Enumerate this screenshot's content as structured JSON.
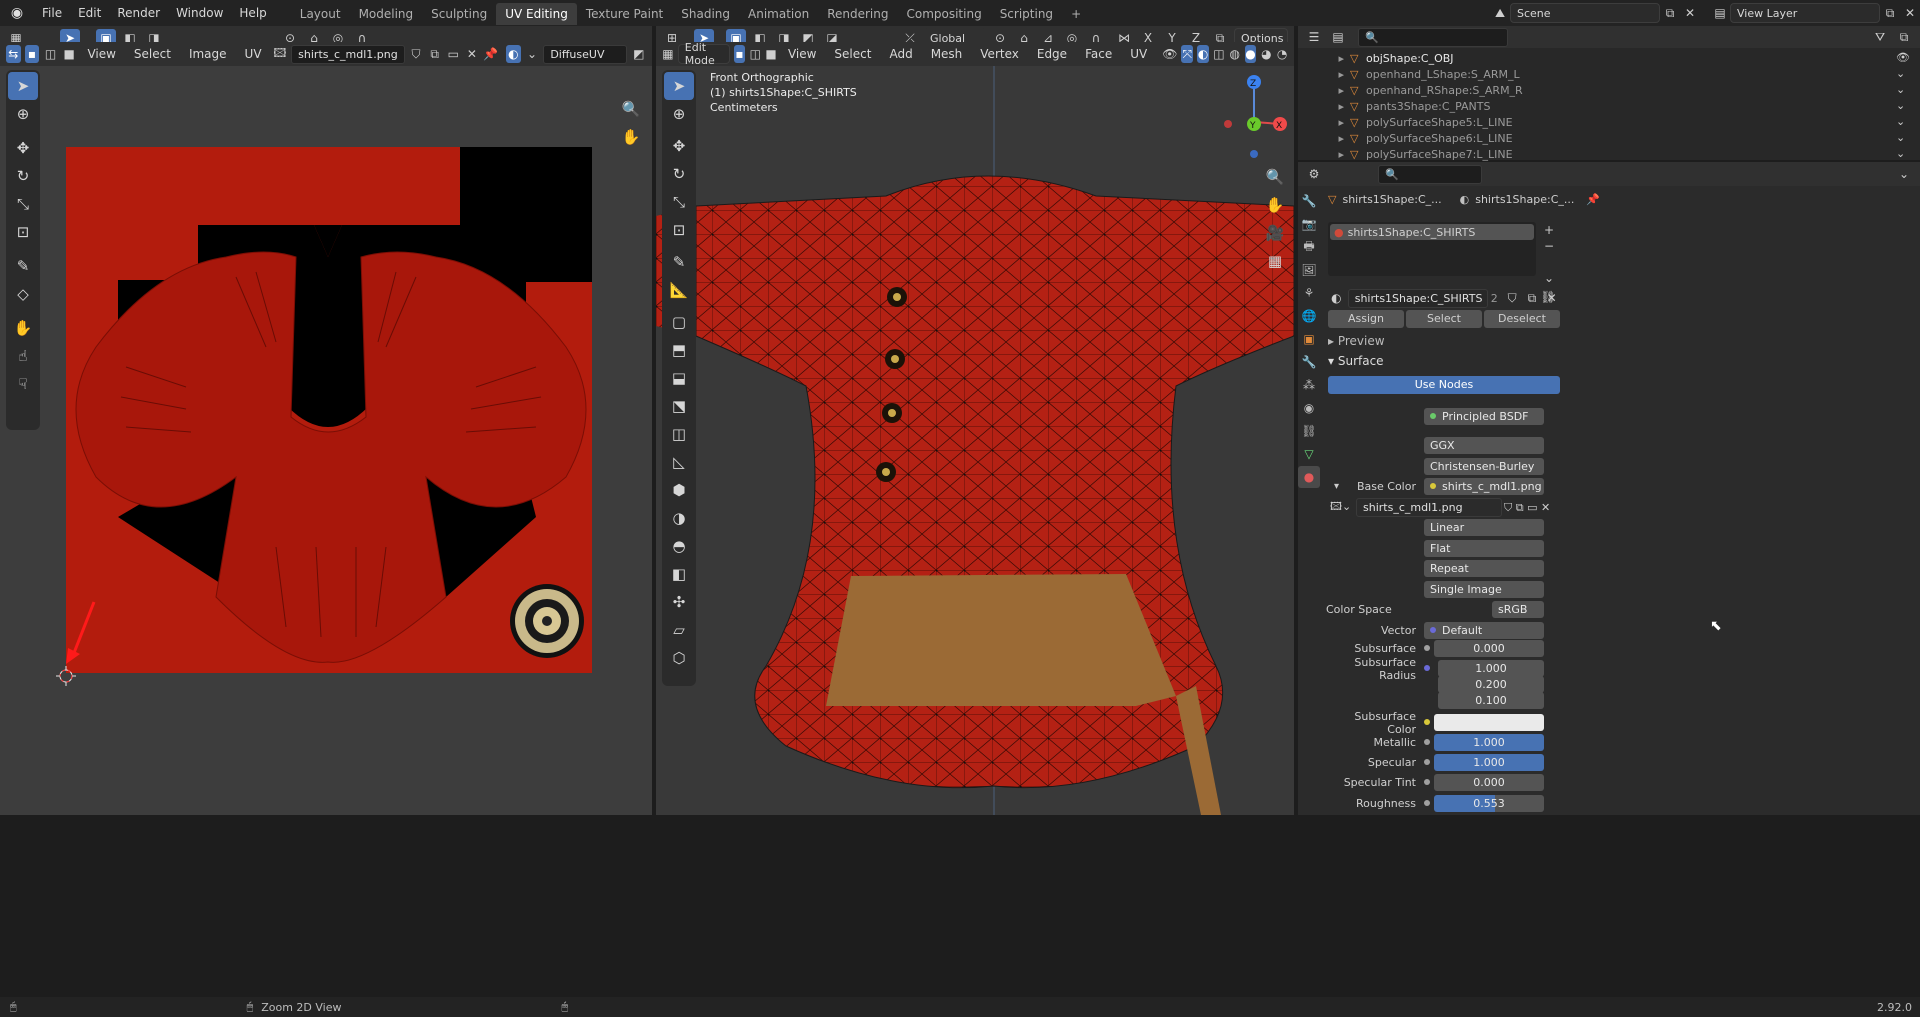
{
  "topbar": {
    "menus": [
      "File",
      "Edit",
      "Render",
      "Window",
      "Help"
    ],
    "workspaces": [
      "Layout",
      "Modeling",
      "Sculpting",
      "UV Editing",
      "Texture Paint",
      "Shading",
      "Animation",
      "Rendering",
      "Compositing",
      "Scripting"
    ],
    "active_workspace": "UV Editing",
    "add_tab": "+",
    "scene": "Scene",
    "view_layer": "View Layer"
  },
  "uv_editor": {
    "menus": [
      "View",
      "Select",
      "Image",
      "UV"
    ],
    "image_name": "shirts_c_mdl1.png",
    "uv_map": "DiffuseUV"
  },
  "viewport": {
    "mode": "Edit Mode",
    "menus": [
      "View",
      "Select",
      "Add",
      "Mesh",
      "Vertex",
      "Edge",
      "Face",
      "UV"
    ],
    "transform_orientation": "Global",
    "options": "Options",
    "view_name": "Front Orthographic",
    "object_info": "(1) shirts1Shape:C_SHIRTS",
    "units": "Centimeters",
    "axes": [
      "X",
      "Y",
      "Z"
    ]
  },
  "outliner": {
    "items": [
      {
        "name": "objShape:C_OBJ"
      },
      {
        "name": "openhand_LShape:S_ARM_L"
      },
      {
        "name": "openhand_RShape:S_ARM_R"
      },
      {
        "name": "pants3Shape:C_PANTS"
      },
      {
        "name": "polySurfaceShape5:L_LINE"
      },
      {
        "name": "polySurfaceShape6:L_LINE"
      },
      {
        "name": "polySurfaceShape7:L_LINE"
      }
    ]
  },
  "properties": {
    "breadcrumb_object": "shirts1Shape:C_...",
    "breadcrumb_material": "shirts1Shape:C_...",
    "slot": "shirts1Shape:C_SHIRTS",
    "material_name": "shirts1Shape:C_SHIRTS",
    "user_count": "2",
    "assign": "Assign",
    "select": "Select",
    "deselect": "Deselect",
    "preview": "Preview",
    "surface_panel": "Surface",
    "use_nodes": "Use Nodes",
    "rows": {
      "surface_label": "Surface",
      "surface_value": "Principled BSDF",
      "distribution": "GGX",
      "subsurface_method": "Christensen-Burley",
      "base_color_label": "Base Color",
      "base_color_value": "shirts_c_mdl1.png",
      "image_name": "shirts_c_mdl1.png",
      "interpolation": "Linear",
      "projection": "Flat",
      "extension": "Repeat",
      "source": "Single Image",
      "color_space_label": "Color Space",
      "color_space": "sRGB",
      "vector_label": "Vector",
      "vector_value": "Default",
      "subsurface_label": "Subsurface",
      "subsurface_value": "0.000",
      "subsurface_radius_label": "Subsurface Radius",
      "radius": [
        "1.000",
        "0.200",
        "0.100"
      ],
      "subsurface_color_label": "Subsurface Color",
      "metallic_label": "Metallic",
      "metallic_value": "1.000",
      "specular_label": "Specular",
      "specular_value": "1.000",
      "specular_tint_label": "Specular Tint",
      "specular_tint_value": "0.000",
      "roughness_label": "Roughness",
      "roughness_value": "0.553"
    }
  },
  "statusbar": {
    "hint": "Zoom 2D View",
    "version": "2.92.0"
  },
  "colors": {
    "accent": "#4772b3",
    "texture_red": "#b31c0d",
    "mesh_red": "#b42114",
    "belt": "#9b6a35"
  },
  "levels": {
    "metallic": 1.0,
    "specular": 1.0,
    "roughness": 0.553
  }
}
